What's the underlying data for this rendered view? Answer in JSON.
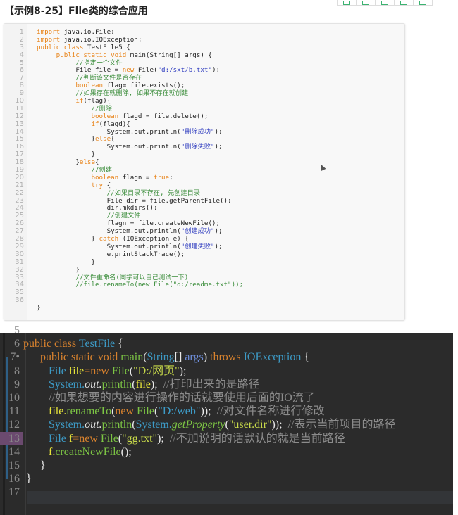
{
  "title": "【示例8-25】File类的综合应用",
  "toolbar": {
    "icons": [
      "copy-icon",
      "share-icon",
      "print-icon",
      "save-icon",
      "more-icon"
    ]
  },
  "code_listing": {
    "lines": [
      {
        "n": "1",
        "t": [
          [
            "kw",
            "import"
          ],
          [
            "pl",
            " java.io.File;"
          ]
        ]
      },
      {
        "n": "2",
        "t": [
          [
            "kw",
            "import"
          ],
          [
            "pl",
            " java.io.IOException;"
          ]
        ]
      },
      {
        "n": "3",
        "t": [
          [
            "kw",
            "public class"
          ],
          [
            "pl",
            " TestFile5 {"
          ]
        ]
      },
      {
        "n": "4",
        "t": [
          [
            "pl",
            "     "
          ],
          [
            "kw",
            "public static void"
          ],
          [
            "pl",
            " main(String[] args) {"
          ]
        ]
      },
      {
        "n": "5",
        "t": [
          [
            "pl",
            "          "
          ],
          [
            "cm",
            "//指定一个文件"
          ]
        ]
      },
      {
        "n": "6",
        "t": [
          [
            "pl",
            "          File file = "
          ],
          [
            "kw",
            "new"
          ],
          [
            "pl",
            " File("
          ],
          [
            "st",
            "\"d:/sxt/b.txt\""
          ],
          [
            "pl",
            ");"
          ]
        ]
      },
      {
        "n": "7",
        "t": [
          [
            "pl",
            "          "
          ],
          [
            "cm",
            "//判断该文件是否存在"
          ]
        ]
      },
      {
        "n": "8",
        "t": [
          [
            "pl",
            "          "
          ],
          [
            "kw",
            "boolean"
          ],
          [
            "pl",
            " flag= file.exists();"
          ]
        ]
      },
      {
        "n": "9",
        "t": [
          [
            "pl",
            "          "
          ],
          [
            "cm",
            "//如果存在就删除, 如果不存在就创建"
          ]
        ]
      },
      {
        "n": "10",
        "t": [
          [
            "pl",
            "          "
          ],
          [
            "kw",
            "if"
          ],
          [
            "pl",
            "(flag){"
          ]
        ]
      },
      {
        "n": "11",
        "t": [
          [
            "pl",
            "              "
          ],
          [
            "cm",
            "//删除"
          ]
        ]
      },
      {
        "n": "12",
        "t": [
          [
            "pl",
            "              "
          ],
          [
            "kw",
            "boolean"
          ],
          [
            "pl",
            " flagd = file.delete();"
          ]
        ]
      },
      {
        "n": "13",
        "t": [
          [
            "pl",
            "              "
          ],
          [
            "kw",
            "if"
          ],
          [
            "pl",
            "(flagd){"
          ]
        ]
      },
      {
        "n": "14",
        "t": [
          [
            "pl",
            "                  System.out.println("
          ],
          [
            "st",
            "\"删除成功\""
          ],
          [
            "pl",
            ");"
          ]
        ]
      },
      {
        "n": "15",
        "t": [
          [
            "pl",
            "              }"
          ],
          [
            "kw",
            "else"
          ],
          [
            "pl",
            "{"
          ]
        ]
      },
      {
        "n": "16",
        "t": [
          [
            "pl",
            "                  System.out.println("
          ],
          [
            "st",
            "\"删除失败\""
          ],
          [
            "pl",
            ");"
          ]
        ]
      },
      {
        "n": "17",
        "t": [
          [
            "pl",
            "              }"
          ]
        ]
      },
      {
        "n": "18",
        "t": [
          [
            "pl",
            "          }"
          ],
          [
            "kw",
            "else"
          ],
          [
            "pl",
            "{"
          ]
        ]
      },
      {
        "n": "19",
        "t": [
          [
            "pl",
            "              "
          ],
          [
            "cm",
            "//创建"
          ]
        ]
      },
      {
        "n": "20",
        "t": [
          [
            "pl",
            "              "
          ],
          [
            "kw",
            "boolean"
          ],
          [
            "pl",
            " flagn = "
          ],
          [
            "kw",
            "true"
          ],
          [
            "pl",
            ";"
          ]
        ]
      },
      {
        "n": "21",
        "t": [
          [
            "pl",
            "              "
          ],
          [
            "kw",
            "try"
          ],
          [
            "pl",
            " {"
          ]
        ]
      },
      {
        "n": "22",
        "t": [
          [
            "pl",
            "                  "
          ],
          [
            "cm",
            "//如果目录不存在, 先创建目录"
          ]
        ]
      },
      {
        "n": "23",
        "t": [
          [
            "pl",
            "                  File dir = file.getParentFile();"
          ]
        ]
      },
      {
        "n": "24",
        "t": [
          [
            "pl",
            "                  dir.mkdirs();"
          ]
        ]
      },
      {
        "n": "25",
        "t": [
          [
            "pl",
            "                  "
          ],
          [
            "cm",
            "//创建文件"
          ]
        ]
      },
      {
        "n": "26",
        "t": [
          [
            "pl",
            "                  flagn = file.createNewFile();"
          ]
        ]
      },
      {
        "n": "27",
        "t": [
          [
            "pl",
            "                  System.out.println("
          ],
          [
            "st",
            "\"创建成功\""
          ],
          [
            "pl",
            ");"
          ]
        ]
      },
      {
        "n": "28",
        "t": [
          [
            "pl",
            "              } "
          ],
          [
            "kw",
            "catch"
          ],
          [
            "pl",
            " (IOException e) {"
          ]
        ]
      },
      {
        "n": "29",
        "t": [
          [
            "pl",
            "                  System.out.println("
          ],
          [
            "st",
            "\"创建失败\""
          ],
          [
            "pl",
            ");"
          ]
        ]
      },
      {
        "n": "30",
        "t": [
          [
            "pl",
            "                  e.printStackTrace();"
          ]
        ]
      },
      {
        "n": "31",
        "t": [
          [
            "pl",
            "              }"
          ]
        ]
      },
      {
        "n": "32",
        "t": [
          [
            "pl",
            "          }"
          ]
        ]
      },
      {
        "n": "33",
        "t": [
          [
            "pl",
            "          "
          ],
          [
            "cm",
            "//文件重命名(同学可以自己测试一下)"
          ]
        ]
      },
      {
        "n": "34",
        "t": [
          [
            "pl",
            "          "
          ],
          [
            "cm",
            "//file.renameTo(new File(\"d:/readme.txt\"));"
          ]
        ]
      },
      {
        "n": "35",
        "t": [
          [
            "pl",
            "     }"
          ]
        ]
      },
      {
        "n": "36",
        "t": [
          [
            "pl",
            "}"
          ]
        ]
      },
      {
        "n": "",
        "t": []
      },
      {
        "n": "",
        "t": []
      }
    ]
  },
  "ide_editor": {
    "lines": [
      {
        "n": "5",
        "t": []
      },
      {
        "n": "6",
        "t": [
          [
            "kw",
            "public class "
          ],
          [
            "ty",
            "TestFile"
          ],
          [
            "pl",
            " {"
          ]
        ]
      },
      {
        "n": "7•",
        "t": [
          [
            "pl",
            "      "
          ],
          [
            "kw",
            "public static void "
          ],
          [
            "fn",
            "main"
          ],
          [
            "pl",
            "("
          ],
          [
            "ty",
            "String"
          ],
          [
            "pl",
            "[] "
          ],
          [
            "ar",
            "args"
          ],
          [
            "pl",
            ") "
          ],
          [
            "kw",
            "throws "
          ],
          [
            "ty",
            "IOException"
          ],
          [
            "pl",
            " {"
          ]
        ]
      },
      {
        "n": "8",
        "t": [
          [
            "pl",
            "         "
          ],
          [
            "ty",
            "File "
          ],
          [
            "var",
            "file"
          ],
          [
            "kw",
            "=new "
          ],
          [
            "fn",
            "File"
          ],
          [
            "pl",
            "("
          ],
          [
            "st",
            "\"D:/网页\""
          ],
          [
            "pl",
            ");"
          ]
        ]
      },
      {
        "n": "9",
        "t": [
          [
            "pl",
            "         "
          ],
          [
            "ty",
            "System."
          ],
          [
            "it",
            "out."
          ],
          [
            "fn",
            "println"
          ],
          [
            "pl",
            "("
          ],
          [
            "var",
            "file"
          ],
          [
            "pl",
            ");  "
          ],
          [
            "cm",
            "//打印出来的是路径"
          ]
        ]
      },
      {
        "n": "10",
        "t": [
          [
            "pl",
            "         "
          ],
          [
            "cm",
            "//如果想要的内容进行操作的话就要使用后面的IO流了"
          ]
        ]
      },
      {
        "n": "11",
        "t": [
          [
            "pl",
            "         "
          ],
          [
            "var",
            "file."
          ],
          [
            "fn",
            "renameTo"
          ],
          [
            "pl",
            "("
          ],
          [
            "kw",
            "new "
          ],
          [
            "fn",
            "File"
          ],
          [
            "pl",
            "("
          ],
          [
            "ty",
            "\"D:/web\""
          ],
          [
            "pl",
            "));  "
          ],
          [
            "cm",
            "//对文件名称进行修改"
          ]
        ]
      },
      {
        "n": "12",
        "t": [
          [
            "pl",
            "         "
          ],
          [
            "ty",
            "System."
          ],
          [
            "it",
            "out."
          ],
          [
            "fn",
            "println"
          ],
          [
            "pl",
            "("
          ],
          [
            "ty",
            "System."
          ],
          [
            "itg",
            "getProperty"
          ],
          [
            "pl",
            "("
          ],
          [
            "st",
            "\"user.dir\""
          ],
          [
            "pl",
            "));  "
          ],
          [
            "cm",
            "//表示当前项目的路径"
          ]
        ]
      },
      {
        "n": "13",
        "t": [
          [
            "pl",
            "         "
          ],
          [
            "ty",
            "File "
          ],
          [
            "var",
            "f"
          ],
          [
            "kw",
            "=new "
          ],
          [
            "fn",
            "File"
          ],
          [
            "pl",
            "("
          ],
          [
            "st",
            "\"gg.txt\""
          ],
          [
            "pl",
            ");  "
          ],
          [
            "cm",
            "//不加说明的话默认的就是当前路径"
          ]
        ]
      },
      {
        "n": "14",
        "t": [
          [
            "pl",
            "         "
          ],
          [
            "var",
            "f."
          ],
          [
            "fn",
            "createNewFile"
          ],
          [
            "pl",
            "();"
          ]
        ]
      },
      {
        "n": "15",
        "t": [
          [
            "pl",
            "      }"
          ]
        ]
      },
      {
        "n": "16",
        "t": [
          [
            "pl",
            " }"
          ]
        ]
      },
      {
        "n": "17",
        "t": []
      }
    ]
  }
}
